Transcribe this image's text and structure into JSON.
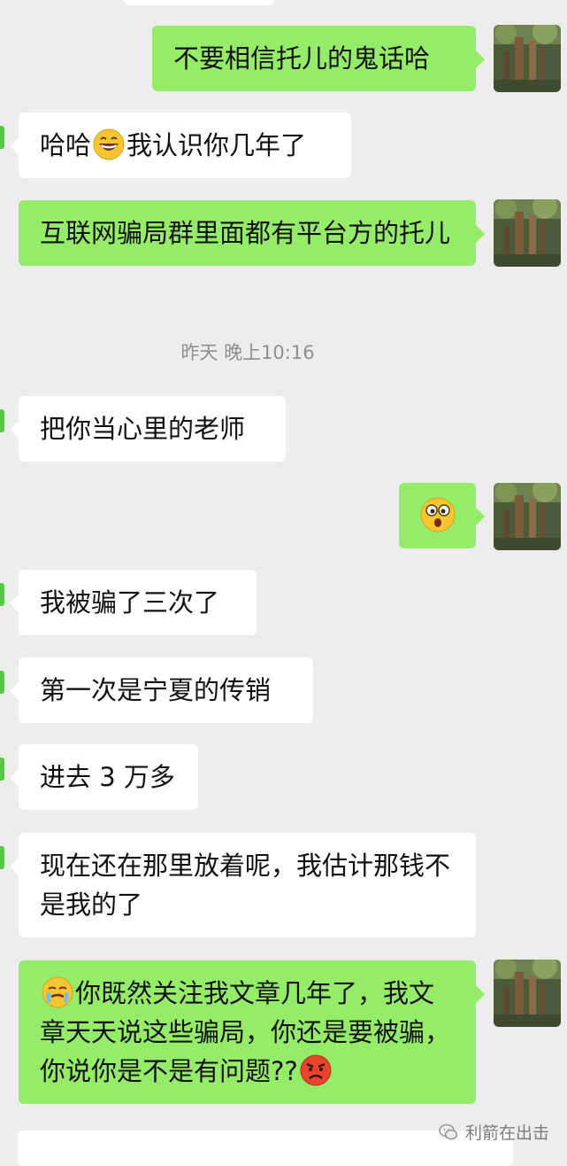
{
  "chat": {
    "messages": [
      {
        "side": "out",
        "text": "不要相信托儿的鬼话哈"
      },
      {
        "side": "in",
        "prefix": "哈哈",
        "emoji": "grin-emoji",
        "text": "我认识你几年了"
      },
      {
        "side": "out",
        "text": "互联网骗局群里面都有平台方的托儿"
      },
      {
        "side": "in",
        "text": "把你当心里的老师"
      },
      {
        "side": "out",
        "emoji": "stunned-emoji"
      },
      {
        "side": "in",
        "text": "我被骗了三次了"
      },
      {
        "side": "in",
        "text": "第一次是宁夏的传销"
      },
      {
        "side": "in",
        "text": "进去 3 万多"
      },
      {
        "side": "in",
        "text": "现在还在那里放着呢，我估计那钱不是我的了"
      },
      {
        "side": "out",
        "lead_emoji": "face-palm-emoji",
        "text": "你既然关注我文章几年了，我文章天天说这些骗局，你还是要被骗，你说你是不是有问题??",
        "trail_emoji": "angry-emoji"
      }
    ],
    "timestamp": "昨天 晚上10:16"
  },
  "watermark": {
    "text": "利箭在出击",
    "icon": "wechat-icon"
  },
  "colors": {
    "background": "#ededed",
    "outgoing_bubble": "#95ec69",
    "incoming_bubble": "#ffffff",
    "timestamp_text": "#8f8f8f"
  }
}
